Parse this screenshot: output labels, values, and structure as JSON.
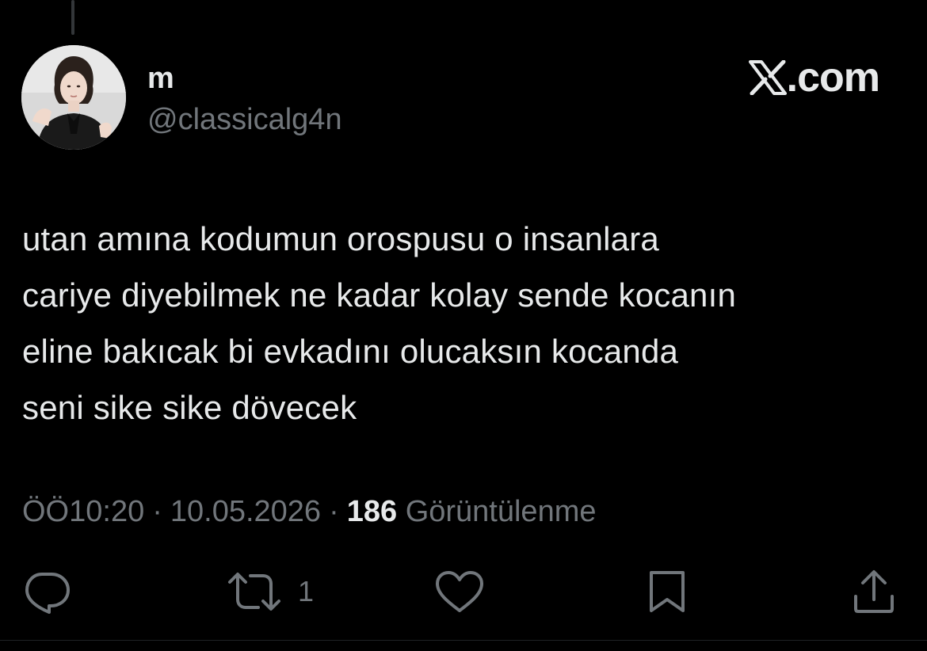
{
  "author": {
    "display_name": "m",
    "handle": "@classicalg4n"
  },
  "brand": {
    "text": ".com"
  },
  "tweet": {
    "text": "utan amına kodumun orospusu o insanlara\ncariye diyebilmek ne kadar kolay sende kocanın\neline bakıcak bi evkadını olucaksın kocanda\nseni sike sike dövecek"
  },
  "meta": {
    "time": "ÖÖ10:20",
    "separator": "·",
    "date": "10.05.2026",
    "views_count": "186",
    "views_label": "Görüntülenme"
  },
  "actions": {
    "reply_icon": "reply-icon",
    "retweet_icon": "retweet-icon",
    "retweet_count": "1",
    "like_icon": "heart-icon",
    "bookmark_icon": "bookmark-icon",
    "share_icon": "share-icon"
  },
  "colors": {
    "background": "#000000",
    "primary_text": "#e7e9ea",
    "secondary_text": "#71767b"
  }
}
